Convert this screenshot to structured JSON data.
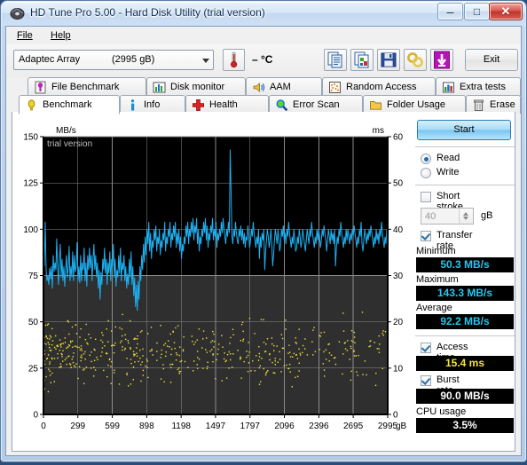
{
  "window": {
    "title": "HD Tune Pro 5.00 - Hard Disk Utility (trial version)",
    "app_icon": "hdtune-icon",
    "minimize_glyph": "–",
    "maximize_glyph": "□",
    "close_glyph": "✕"
  },
  "menu": {
    "items": [
      {
        "label": "File",
        "accel": "F"
      },
      {
        "label": "Help",
        "accel": "H"
      }
    ]
  },
  "toolbar": {
    "device": {
      "name": "Adaptec Array",
      "capacity": "(2995 gB)"
    },
    "temperature": "– °C",
    "buttons": [
      {
        "name": "copy-icon",
        "label": ""
      },
      {
        "name": "copy-image-icon",
        "label": ""
      },
      {
        "name": "save-icon",
        "label": ""
      },
      {
        "name": "settings-icon",
        "label": ""
      },
      {
        "name": "download-icon",
        "label": ""
      }
    ],
    "exit_label": "Exit"
  },
  "tabs": {
    "row1": [
      {
        "label": "File Benchmark",
        "icon": "file-benchmark-icon",
        "active": false
      },
      {
        "label": "Disk monitor",
        "icon": "disk-monitor-icon",
        "active": false
      },
      {
        "label": "AAM",
        "icon": "aam-speaker-icon",
        "active": false
      },
      {
        "label": "Random Access",
        "icon": "random-access-icon",
        "active": false
      },
      {
        "label": "Extra tests",
        "icon": "extra-tests-icon",
        "active": false
      }
    ],
    "row2": [
      {
        "label": "Benchmark",
        "icon": "benchmark-bulb-icon",
        "active": true
      },
      {
        "label": "Info",
        "icon": "info-icon",
        "active": false
      },
      {
        "label": "Health",
        "icon": "health-cross-icon",
        "active": false
      },
      {
        "label": "Error Scan",
        "icon": "error-scan-magnifier-icon",
        "active": false
      },
      {
        "label": "Folder Usage",
        "icon": "folder-usage-icon",
        "active": false
      },
      {
        "label": "Erase",
        "icon": "erase-trash-icon",
        "active": false
      }
    ]
  },
  "panel": {
    "start_label": "Start",
    "mode": {
      "read_label": "Read",
      "write_label": "Write",
      "selected": "Read"
    },
    "short_stroke": {
      "label": "Short stroke",
      "checked": false,
      "value": "40",
      "unit": "gB"
    },
    "transfer_rate": {
      "label": "Transfer rate",
      "checked": true
    },
    "minimum": {
      "label": "Minimum",
      "value": "50.3 MB/s"
    },
    "maximum": {
      "label": "Maximum",
      "value": "143.3 MB/s"
    },
    "average": {
      "label": "Average",
      "value": "92.2 MB/s"
    },
    "access_time": {
      "label": "Access time",
      "checked": true,
      "value": "15.4 ms"
    },
    "burst_rate": {
      "label": "Burst rate",
      "checked": true,
      "value": "90.0 MB/s"
    },
    "cpu_usage": {
      "label": "CPU usage",
      "value": "3.5%"
    }
  },
  "chart_data": {
    "type": "line",
    "title": "",
    "watermark": "trial version",
    "ylabel": "MB/s",
    "y2label": "ms",
    "xlabel": "gB",
    "xlim": [
      0,
      2995
    ],
    "ylim": [
      0,
      150
    ],
    "y2lim": [
      0,
      60
    ],
    "grid": true,
    "background": "#2f2f2f",
    "plot_background_top": "#000000",
    "y_ticks": [
      0,
      25,
      50,
      75,
      100,
      125,
      150
    ],
    "y2_ticks": [
      0,
      10,
      20,
      30,
      40,
      50,
      60
    ],
    "x_ticks": [
      0,
      299,
      599,
      898,
      1198,
      1497,
      1797,
      2096,
      2396,
      2695,
      2995
    ],
    "x_tick_labels": [
      "0",
      "299",
      "599",
      "898",
      "1198",
      "1497",
      "1797",
      "2096",
      "2396",
      "2695",
      "2995"
    ],
    "series": [
      {
        "name": "Transfer rate",
        "color": "#1eb0f0",
        "axis": "left",
        "unit": "MB/s",
        "values": [
          91,
          80,
          104,
          78,
          72,
          75,
          70,
          79,
          73,
          80,
          68,
          86,
          77,
          82,
          78,
          95,
          79,
          70,
          84,
          92,
          74,
          84,
          72,
          80,
          69,
          78,
          86,
          74,
          79,
          91,
          72,
          80,
          74,
          88,
          72,
          86,
          77,
          80,
          93,
          72,
          80,
          71,
          86,
          72,
          82,
          78,
          90,
          72,
          82,
          69,
          86,
          78,
          90,
          79,
          86,
          72,
          84,
          92,
          78,
          86,
          74,
          82,
          68,
          78,
          62,
          77,
          70,
          84,
          78,
          90,
          76,
          84,
          70,
          82,
          76,
          88,
          72,
          84,
          80,
          92,
          74,
          84,
          69,
          78,
          74,
          86,
          76,
          90,
          72,
          82,
          78,
          86,
          72,
          80,
          68,
          76,
          70,
          84,
          74,
          88,
          70,
          80,
          64,
          74,
          58,
          70,
          56,
          72,
          62,
          80,
          72,
          86,
          78,
          92,
          82,
          96,
          86,
          100,
          92,
          104,
          88,
          98,
          84,
          94,
          90,
          100,
          94,
          102,
          88,
          96,
          92,
          100,
          86,
          94,
          90,
          98,
          94,
          104,
          88,
          96,
          92,
          100,
          96,
          104,
          90,
          98,
          94,
          102,
          96,
          104,
          90,
          98,
          92,
          100,
          88,
          96,
          84,
          92,
          88,
          96,
          92,
          102,
          96,
          104,
          92,
          100,
          96,
          104,
          98,
          106,
          94,
          102,
          98,
          106,
          92,
          100,
          88,
          96,
          92,
          100,
          96,
          104,
          98,
          106,
          94,
          102,
          90,
          98,
          94,
          102,
          98,
          106,
          94,
          100,
          96,
          104,
          90,
          98,
          94,
          100,
          96,
          104,
          98,
          106,
          100,
          96,
          92,
          100,
          96,
          104,
          98,
          143,
          120,
          96,
          92,
          100,
          96,
          104,
          98,
          94,
          92,
          100,
          96,
          102,
          94,
          100,
          92,
          98,
          90,
          96,
          94,
          102,
          96,
          90,
          94,
          100,
          96,
          104,
          98,
          94,
          90,
          96,
          92,
          100,
          84,
          96,
          90,
          98,
          94,
          100,
          78,
          88,
          94,
          100,
          96,
          90,
          94,
          100,
          92,
          80,
          86,
          94,
          100,
          96,
          92,
          100,
          94,
          88,
          92,
          100,
          96,
          102,
          94,
          98,
          92,
          100,
          96,
          104,
          98,
          94,
          90,
          96,
          92,
          100,
          94,
          88,
          90,
          96,
          92,
          100,
          96,
          90,
          94,
          100,
          96,
          92,
          88,
          94,
          100,
          96,
          92,
          100,
          96,
          104,
          98,
          94,
          90,
          96,
          92,
          100,
          94,
          100,
          96,
          90,
          94,
          100,
          96,
          102,
          98,
          94,
          88,
          94,
          100,
          96,
          92,
          100,
          94,
          98,
          92,
          100,
          80,
          90,
          96,
          92,
          100,
          96,
          104,
          98,
          94,
          90,
          96,
          92,
          100,
          94,
          100,
          96,
          92,
          98,
          94,
          100,
          96,
          102,
          98,
          94,
          90,
          96,
          92,
          100,
          96,
          104,
          92,
          88,
          94,
          100,
          96,
          92,
          98,
          94,
          100,
          96,
          102,
          98,
          94,
          90,
          96,
          92,
          100,
          94,
          98,
          92,
          100,
          96,
          104,
          98,
          94,
          90,
          96,
          92,
          100,
          96
        ]
      },
      {
        "name": "Access time",
        "color": "#f2e33c",
        "axis": "right",
        "unit": "ms",
        "marker": "dot",
        "mean": 15.4,
        "range": [
          4,
          23
        ],
        "n_points": 520,
        "density_note": "denser near the start of the drive, thinning toward the end"
      }
    ]
  }
}
